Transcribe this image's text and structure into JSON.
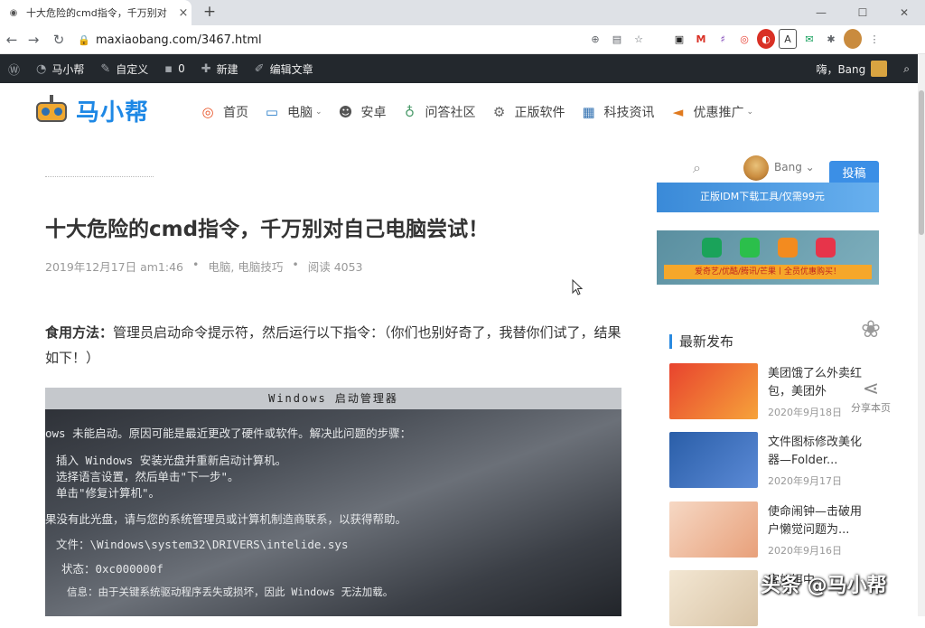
{
  "browser": {
    "tab_title": "十大危险的cmd指令，千万别对",
    "url": "maxiaobang.com/3467.html"
  },
  "wpbar": {
    "site": "马小帮",
    "customize": "自定义",
    "comments": "0",
    "new": "新建",
    "edit": "编辑文章",
    "greeting": "嗨，Bang"
  },
  "site": {
    "logo": "马小帮",
    "menu": [
      "首页",
      "电脑",
      "安卓",
      "问答社区",
      "正版软件",
      "科技资讯",
      "优惠推广"
    ]
  },
  "article": {
    "title": "十大危险的cmd指令，千万别对自己电脑尝试！",
    "date": "2019年12月17日 am1:46",
    "category": "电脑, 电脑技巧",
    "views": "阅读 4053",
    "label": "食用方法：",
    "text": "管理员启动命令提示符，然后运行以下指令：（你们也别好奇了，我替你们试了，结果如下！）"
  },
  "screen_photo": {
    "header": "Windows 启动管理器",
    "lines": [
      "ows 未能启动。原因可能是最近更改了硬件或软件。解决此问题的步骤：",
      "插入 Windows 安装光盘并重新启动计算机。",
      "选择语言设置，然后单击\"下一步\"。",
      "单击\"修复计算机\"。",
      "果没有此光盘，请与您的系统管理员或计算机制造商联系，以获得帮助。",
      "文件：\\Windows\\system32\\DRIVERS\\intelide.sys",
      "状态：0xc000000f",
      "信息：由于关键系统驱动程序丢失或损坏，因此 Windows 无法加载。"
    ]
  },
  "sidebar": {
    "user": "Bang",
    "submit": "投稿",
    "banner1": "正版IDM下载工具/仅需99元",
    "banner2": "爱奇艺/优酷/腾讯/芒果丨全员优惠购买！",
    "section": "最新发布",
    "posts": [
      {
        "title": "美团饿了么外卖红包，美团外",
        "date": "2020年9月18日"
      },
      {
        "title": "文件图标修改美化器—Folder...",
        "date": "2020年9月17日"
      },
      {
        "title": "使命闹钟—击破用户懒觉问题为...",
        "date": "2020年9月16日"
      },
      {
        "title": "客如饵中…",
        "date": ""
      }
    ]
  },
  "float": {
    "share": "分享本页"
  },
  "watermark": "头条 @马小帮"
}
